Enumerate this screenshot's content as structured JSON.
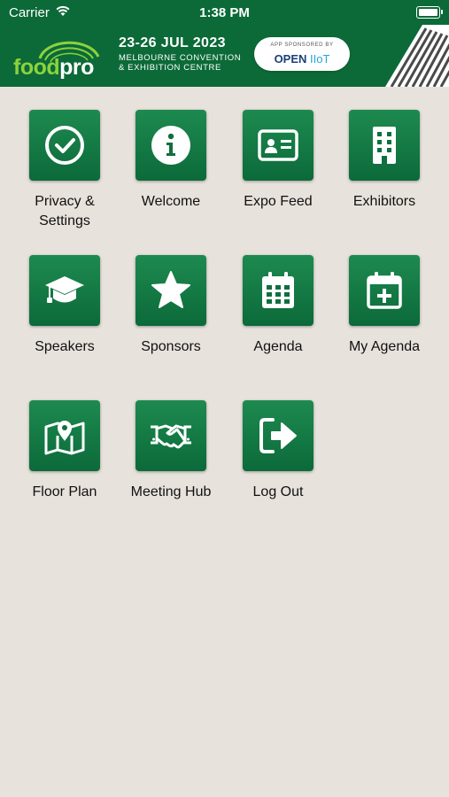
{
  "status_bar": {
    "carrier": "Carrier",
    "time": "1:38 PM"
  },
  "banner": {
    "logo_food": "food",
    "logo_pro": "pro",
    "event_date": "23-26 JUL 2023",
    "venue_line1": "MELBOURNE CONVENTION",
    "venue_line2": "& EXHIBITION CENTRE",
    "sponsor_caption": "APP SPONSORED BY",
    "sponsor_brand": "OPEN",
    "sponsor_brand_accent": "IIoT"
  },
  "menu": [
    {
      "label": "Privacy & Settings",
      "icon": "check-circle-icon"
    },
    {
      "label": "Welcome",
      "icon": "info-icon"
    },
    {
      "label": "Expo Feed",
      "icon": "id-card-icon"
    },
    {
      "label": "Exhibitors",
      "icon": "building-icon"
    },
    {
      "label": "Speakers",
      "icon": "graduation-cap-icon"
    },
    {
      "label": "Sponsors",
      "icon": "star-icon"
    },
    {
      "label": "Agenda",
      "icon": "calendar-icon"
    },
    {
      "label": "My Agenda",
      "icon": "calendar-plus-icon"
    },
    {
      "label": "Floor Plan",
      "icon": "map-pin-icon"
    },
    {
      "label": "Meeting Hub",
      "icon": "handshake-icon"
    },
    {
      "label": "Log Out",
      "icon": "sign-out-icon"
    }
  ],
  "colors": {
    "tile": "#0f6f3e",
    "banner": "#0b6a38",
    "background": "#e8e2dc",
    "logo_accent": "#8cd23c"
  }
}
